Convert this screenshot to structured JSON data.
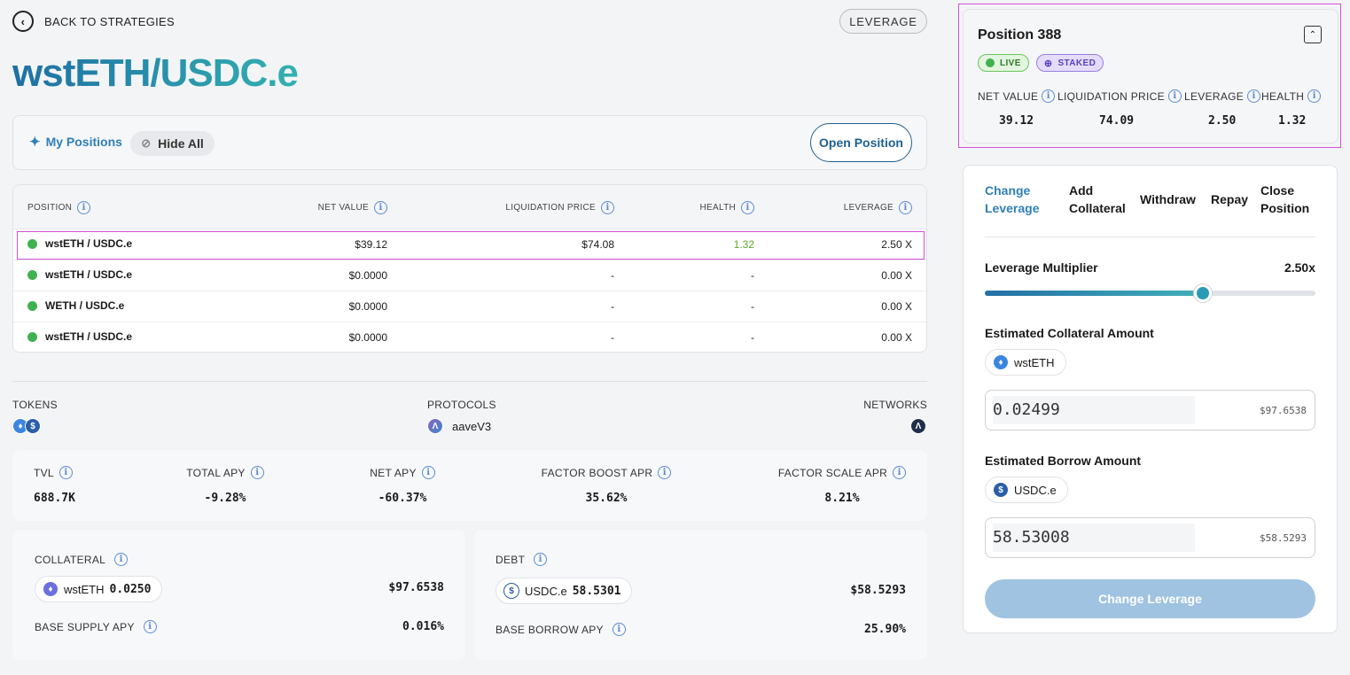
{
  "nav": {
    "back_label": "BACK TO STRATEGIES",
    "leverage_pill": "LEVERAGE"
  },
  "strategy": {
    "title": "wstETH/USDC.e"
  },
  "positions_bar": {
    "my_positions": "My Positions",
    "hide_all": "Hide All",
    "open_position": "Open Position"
  },
  "table": {
    "headers": [
      "POSITION",
      "NET VALUE",
      "LIQUIDATION PRICE",
      "HEALTH",
      "LEVERAGE"
    ],
    "rows": [
      {
        "pair": "wstETH / USDC.e",
        "net_value": "$39.12",
        "liq_price": "$74.08",
        "health": "1.32",
        "leverage": "2.50 X"
      },
      {
        "pair": "wstETH / USDC.e",
        "net_value": "$0.0000",
        "liq_price": "-",
        "health": "-",
        "leverage": "0.00 X"
      },
      {
        "pair": "WETH / USDC.e",
        "net_value": "$0.0000",
        "liq_price": "-",
        "health": "-",
        "leverage": "0.00 X"
      },
      {
        "pair": "wstETH / USDC.e",
        "net_value": "$0.0000",
        "liq_price": "-",
        "health": "-",
        "leverage": "0.00 X"
      }
    ]
  },
  "meta": {
    "tokens_label": "TOKENS",
    "protocols_label": "PROTOCOLS",
    "protocol_name": "aaveV3",
    "networks_label": "NETWORKS"
  },
  "stats": [
    {
      "label": "TVL",
      "value": "688.7K"
    },
    {
      "label": "TOTAL APY",
      "value": "-9.28%"
    },
    {
      "label": "NET APY",
      "value": "-60.37%"
    },
    {
      "label": "FACTOR BOOST APR",
      "value": "35.62%"
    },
    {
      "label": "FACTOR SCALE APR",
      "value": "8.21%"
    }
  ],
  "collateral": {
    "label": "COLLATERAL",
    "token": "wstETH",
    "amount": "0.0250",
    "usd": "$97.6538",
    "apy_label": "BASE SUPPLY APY",
    "apy": "0.016%"
  },
  "debt": {
    "label": "DEBT",
    "token": "USDC.e",
    "amount": "58.5301",
    "usd": "$58.5293",
    "apy_label": "BASE BORROW APY",
    "apy": "25.90%"
  },
  "position_card": {
    "title": "Position 388",
    "badges": [
      "LIVE",
      "STAKED"
    ],
    "metrics": [
      {
        "label": "NET VALUE",
        "value": "39.12"
      },
      {
        "label": "LIQUIDATION PRICE",
        "value": "74.09"
      },
      {
        "label": "LEVERAGE",
        "value": "2.50"
      },
      {
        "label": "HEALTH",
        "value": "1.32"
      }
    ]
  },
  "action_panel": {
    "tabs": [
      {
        "line1": "Change",
        "line2": "Leverage"
      },
      {
        "line1": "Add",
        "line2": "Collateral"
      },
      {
        "line1": "Withdraw",
        "line2": ""
      },
      {
        "line1": "Repay",
        "line2": ""
      },
      {
        "line1": "Close",
        "line2": "Position"
      }
    ],
    "leverage_label": "Leverage Multiplier",
    "leverage_value": "2.50x",
    "slider_fraction": 0.66,
    "collateral_label": "Estimated Collateral Amount",
    "collateral_token": "wstETH",
    "collateral_amount": "0.02499",
    "collateral_usd": "$97.6538",
    "borrow_label": "Estimated Borrow Amount",
    "borrow_token": "USDC.e",
    "borrow_amount": "58.53008",
    "borrow_usd": "$58.5293",
    "submit": "Change Leverage"
  },
  "colors": {
    "accent": "#2f7fb8",
    "live": "#3fb24f",
    "staked": "#7a5ad8",
    "highlight": "#d54fd9",
    "button": "#9fc3e0"
  }
}
